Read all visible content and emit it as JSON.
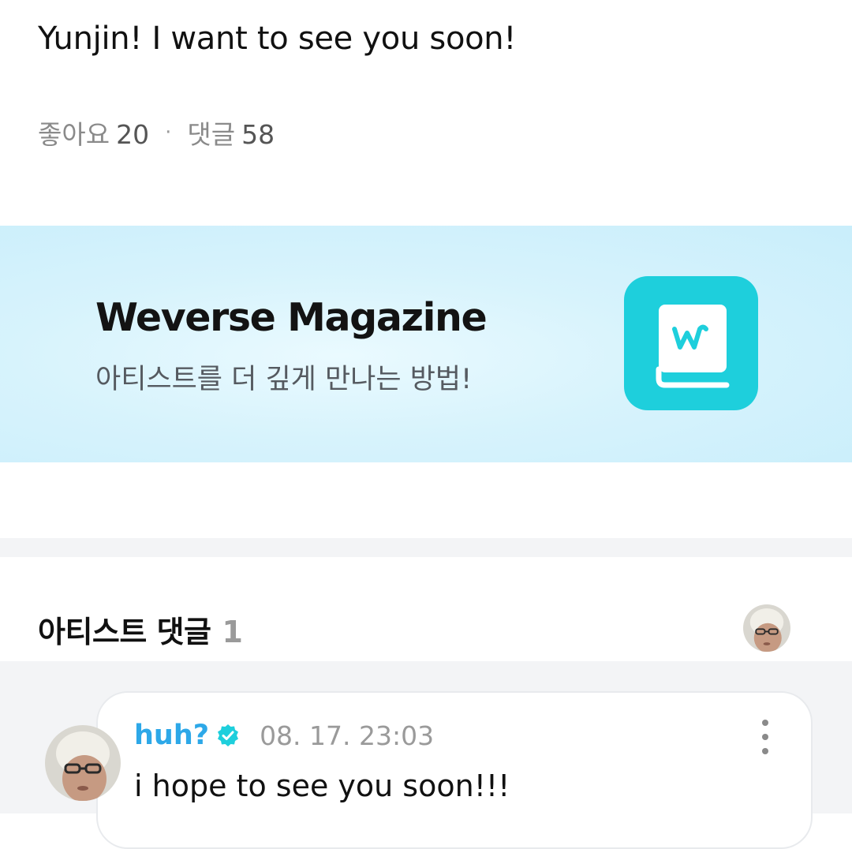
{
  "post": {
    "text": "Yunjin! I want to see you soon!",
    "likes_label": "좋아요",
    "likes_count": "20",
    "separator": "·",
    "comments_label": "댓글",
    "comments_count": "58"
  },
  "banner": {
    "title": "Weverse Magazine",
    "subtitle": "아티스트를 더 깊게 만나는 방법!",
    "icon": "weverse-magazine-book-icon",
    "icon_color": "#1ECFDC"
  },
  "artist_comments": {
    "title": "아티스트 댓글",
    "count": "1",
    "header_avatar_icon": "profile-avatar"
  },
  "comments": [
    {
      "author": "huh?",
      "verified_icon": "verified-badge-icon",
      "timestamp": "08. 17. 23:03",
      "text": "i hope to see you soon!!!",
      "more_icon": "more-vertical-icon"
    }
  ],
  "colors": {
    "author": "#2DA8E8",
    "verified": "#1ECFDC",
    "muted": "#9A9A9A",
    "band": "#F3F4F6"
  }
}
